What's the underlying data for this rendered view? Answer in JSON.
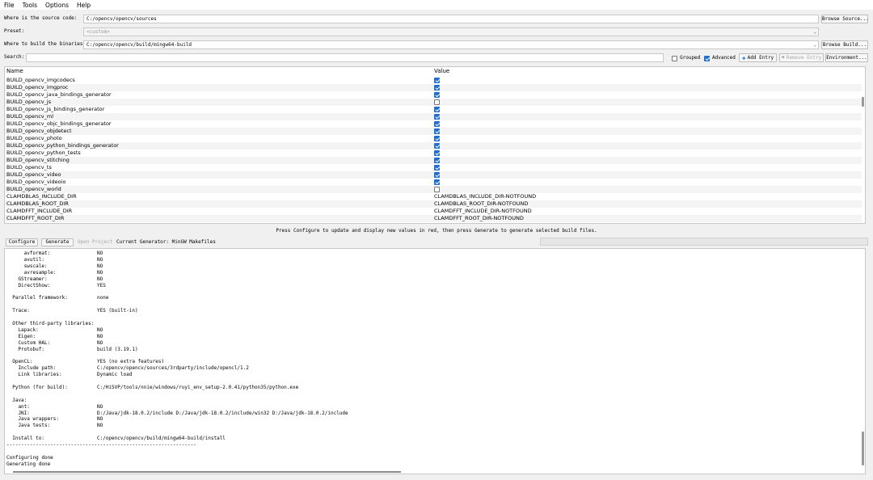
{
  "menu": [
    "File",
    "Tools",
    "Options",
    "Help"
  ],
  "source": {
    "label": "Where is the source code:",
    "value": "C:/opencv/opencv/sources",
    "browse": "Browse Source..."
  },
  "preset": {
    "label": "Preset:",
    "value": "<custom>"
  },
  "build": {
    "label": "Where to build the binaries:",
    "value": "C:/opencv/opencv/build/mingw64-build",
    "browse": "Browse Build..."
  },
  "search": {
    "label": "Search:",
    "value": ""
  },
  "options": {
    "grouped": {
      "label": "Grouped",
      "checked": false
    },
    "advanced": {
      "label": "Advanced",
      "checked": true
    },
    "add_entry": "Add Entry",
    "remove_entry": "Remove Entry",
    "environment": "Environment..."
  },
  "table": {
    "headers": {
      "name": "Name",
      "value": "Value"
    },
    "rows": [
      {
        "name": "BUILD_opencv_imgcodecs",
        "type": "bool",
        "value": true
      },
      {
        "name": "BUILD_opencv_imgproc",
        "type": "bool",
        "value": true
      },
      {
        "name": "BUILD_opencv_java_bindings_generator",
        "type": "bool",
        "value": true
      },
      {
        "name": "BUILD_opencv_js",
        "type": "bool",
        "value": false
      },
      {
        "name": "BUILD_opencv_js_bindings_generator",
        "type": "bool",
        "value": true
      },
      {
        "name": "BUILD_opencv_ml",
        "type": "bool",
        "value": true
      },
      {
        "name": "BUILD_opencv_objc_bindings_generator",
        "type": "bool",
        "value": true
      },
      {
        "name": "BUILD_opencv_objdetect",
        "type": "bool",
        "value": true
      },
      {
        "name": "BUILD_opencv_photo",
        "type": "bool",
        "value": true
      },
      {
        "name": "BUILD_opencv_python_bindings_generator",
        "type": "bool",
        "value": true
      },
      {
        "name": "BUILD_opencv_python_tests",
        "type": "bool",
        "value": true
      },
      {
        "name": "BUILD_opencv_stitching",
        "type": "bool",
        "value": true
      },
      {
        "name": "BUILD_opencv_ts",
        "type": "bool",
        "value": true
      },
      {
        "name": "BUILD_opencv_video",
        "type": "bool",
        "value": true
      },
      {
        "name": "BUILD_opencv_videoio",
        "type": "bool",
        "value": true
      },
      {
        "name": "BUILD_opencv_world",
        "type": "bool",
        "value": false
      },
      {
        "name": "CLAMDBLAS_INCLUDE_DIR",
        "type": "text",
        "value": "CLAMDBLAS_INCLUDE_DIR-NOTFOUND"
      },
      {
        "name": "CLAMDBLAS_ROOT_DIR",
        "type": "text",
        "value": "CLAMDBLAS_ROOT_DIR-NOTFOUND"
      },
      {
        "name": "CLAMDFFT_INCLUDE_DIR",
        "type": "text",
        "value": "CLAMDFFT_INCLUDE_DIR-NOTFOUND"
      },
      {
        "name": "CLAMDFFT_ROOT_DIR",
        "type": "text",
        "value": "CLAMDFFT_ROOT_DIR-NOTFOUND"
      }
    ]
  },
  "status_message": "Press Configure to update and display new values in red, then press Generate to generate selected build files.",
  "actions": {
    "configure": "Configure",
    "generate": "Generate",
    "open_project": "Open Project",
    "current_generator": "Current Generator: MinGW Makefiles"
  },
  "output_lines": [
    "      avformat:                NO",
    "      avutil:                  NO",
    "      swscale:                 NO",
    "      avresample:              NO",
    "    GStreamer:                 NO",
    "    DirectShow:                YES",
    "",
    "  Parallel framework:          none",
    "",
    "  Trace:                       YES (built-in)",
    "",
    "  Other third-party libraries:",
    "    Lapack:                    NO",
    "    Eigen:                     NO",
    "    Custom HAL:                NO",
    "    Protobuf:                  build (3.19.1)",
    "",
    "  OpenCL:                      YES (no extra features)",
    "    Include path:              C:/opencv/opencv/sources/3rdparty/include/opencl/1.2",
    "    Link libraries:            Dynamic load",
    "",
    "  Python (for build):          C:/HiSVP/tools/nnie/windows/ruyi_env_setup-2.0.41/python35/python.exe",
    "",
    "  Java:",
    "    ant:                       NO",
    "    JNI:                       D:/Java/jdk-18.0.2/include D:/Java/jdk-18.0.2/include/win32 D:/Java/jdk-18.0.2/include",
    "    Java wrappers:             NO",
    "    Java tests:                NO",
    "",
    "  Install to:                  C:/opencv/opencv/build/mingw64-build/install",
    "-----------------------------------------------------------------",
    "",
    "Configuring done",
    "Generating done"
  ]
}
